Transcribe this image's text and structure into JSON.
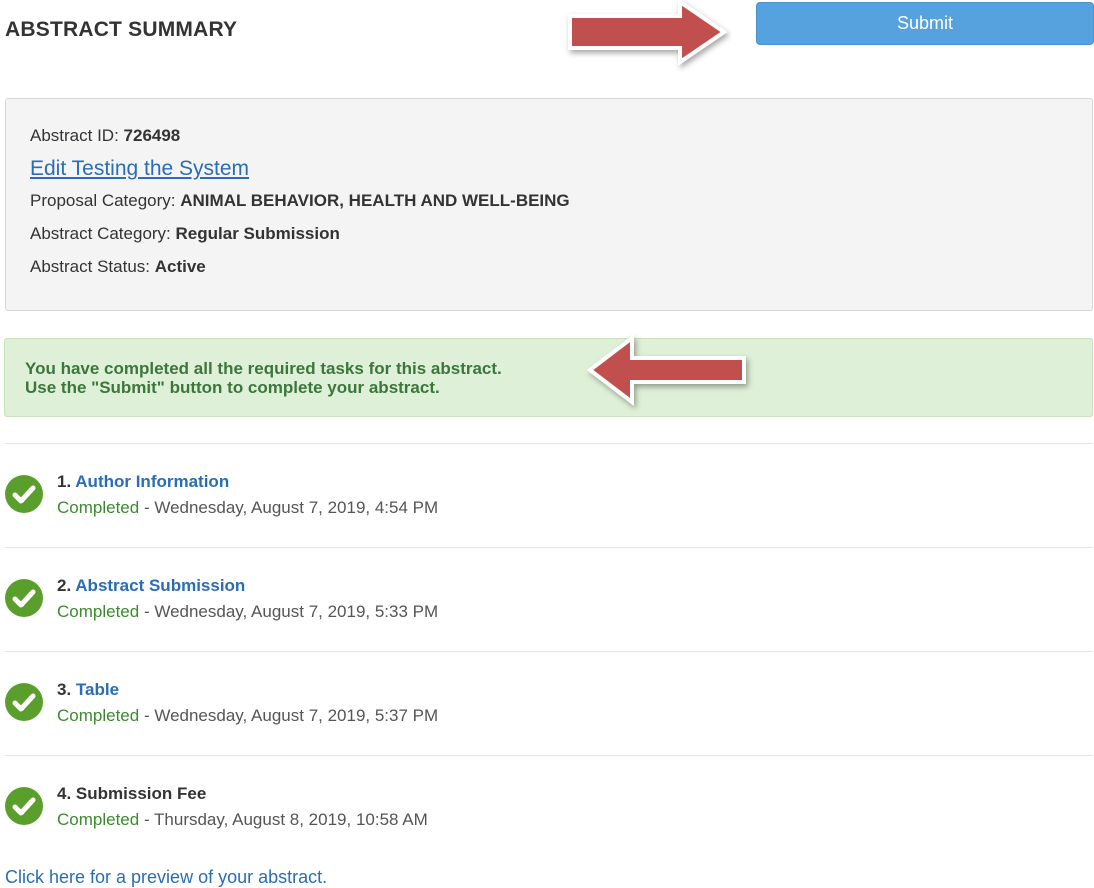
{
  "header": {
    "title": "ABSTRACT SUMMARY",
    "submit_label": "Submit"
  },
  "summary": {
    "abstract_id_label": "Abstract ID: ",
    "abstract_id": "726498",
    "edit_link": "Edit Testing the System",
    "proposal_category_label": "Proposal Category: ",
    "proposal_category": "ANIMAL BEHAVIOR, HEALTH AND WELL-BEING",
    "abstract_category_label": "Abstract Category: ",
    "abstract_category": "Regular Submission",
    "abstract_status_label": "Abstract Status: ",
    "abstract_status": "Active"
  },
  "alert": {
    "line1": "You have completed all the required tasks for this abstract.",
    "line2": "Use the \"Submit\" button to complete your abstract."
  },
  "tasks": [
    {
      "number": "1.",
      "title": "Author Information",
      "status": "Completed",
      "timestamp": " - Wednesday, August 7, 2019, 4:54 PM"
    },
    {
      "number": "2.",
      "title": "Abstract Submission",
      "status": "Completed",
      "timestamp": " - Wednesday, August 7, 2019, 5:33 PM"
    },
    {
      "number": "3.",
      "title": "Table",
      "status": "Completed",
      "timestamp": " - Wednesday, August 7, 2019, 5:37 PM"
    },
    {
      "number": "4.",
      "title": "Submission Fee",
      "status": "Completed",
      "timestamp": " - Thursday, August 8, 2019, 10:58 AM"
    }
  ],
  "preview_link": "Click here for a preview of your abstract.",
  "icons": {
    "task_status": "check-circle-icon",
    "annotation": "red-arrow-icon"
  },
  "colors": {
    "accent": "#55a2df",
    "link": "#2a6db5",
    "success": "#5a9f2c",
    "alert_bg": "#dff0d8",
    "arrow": "#c0504d"
  }
}
